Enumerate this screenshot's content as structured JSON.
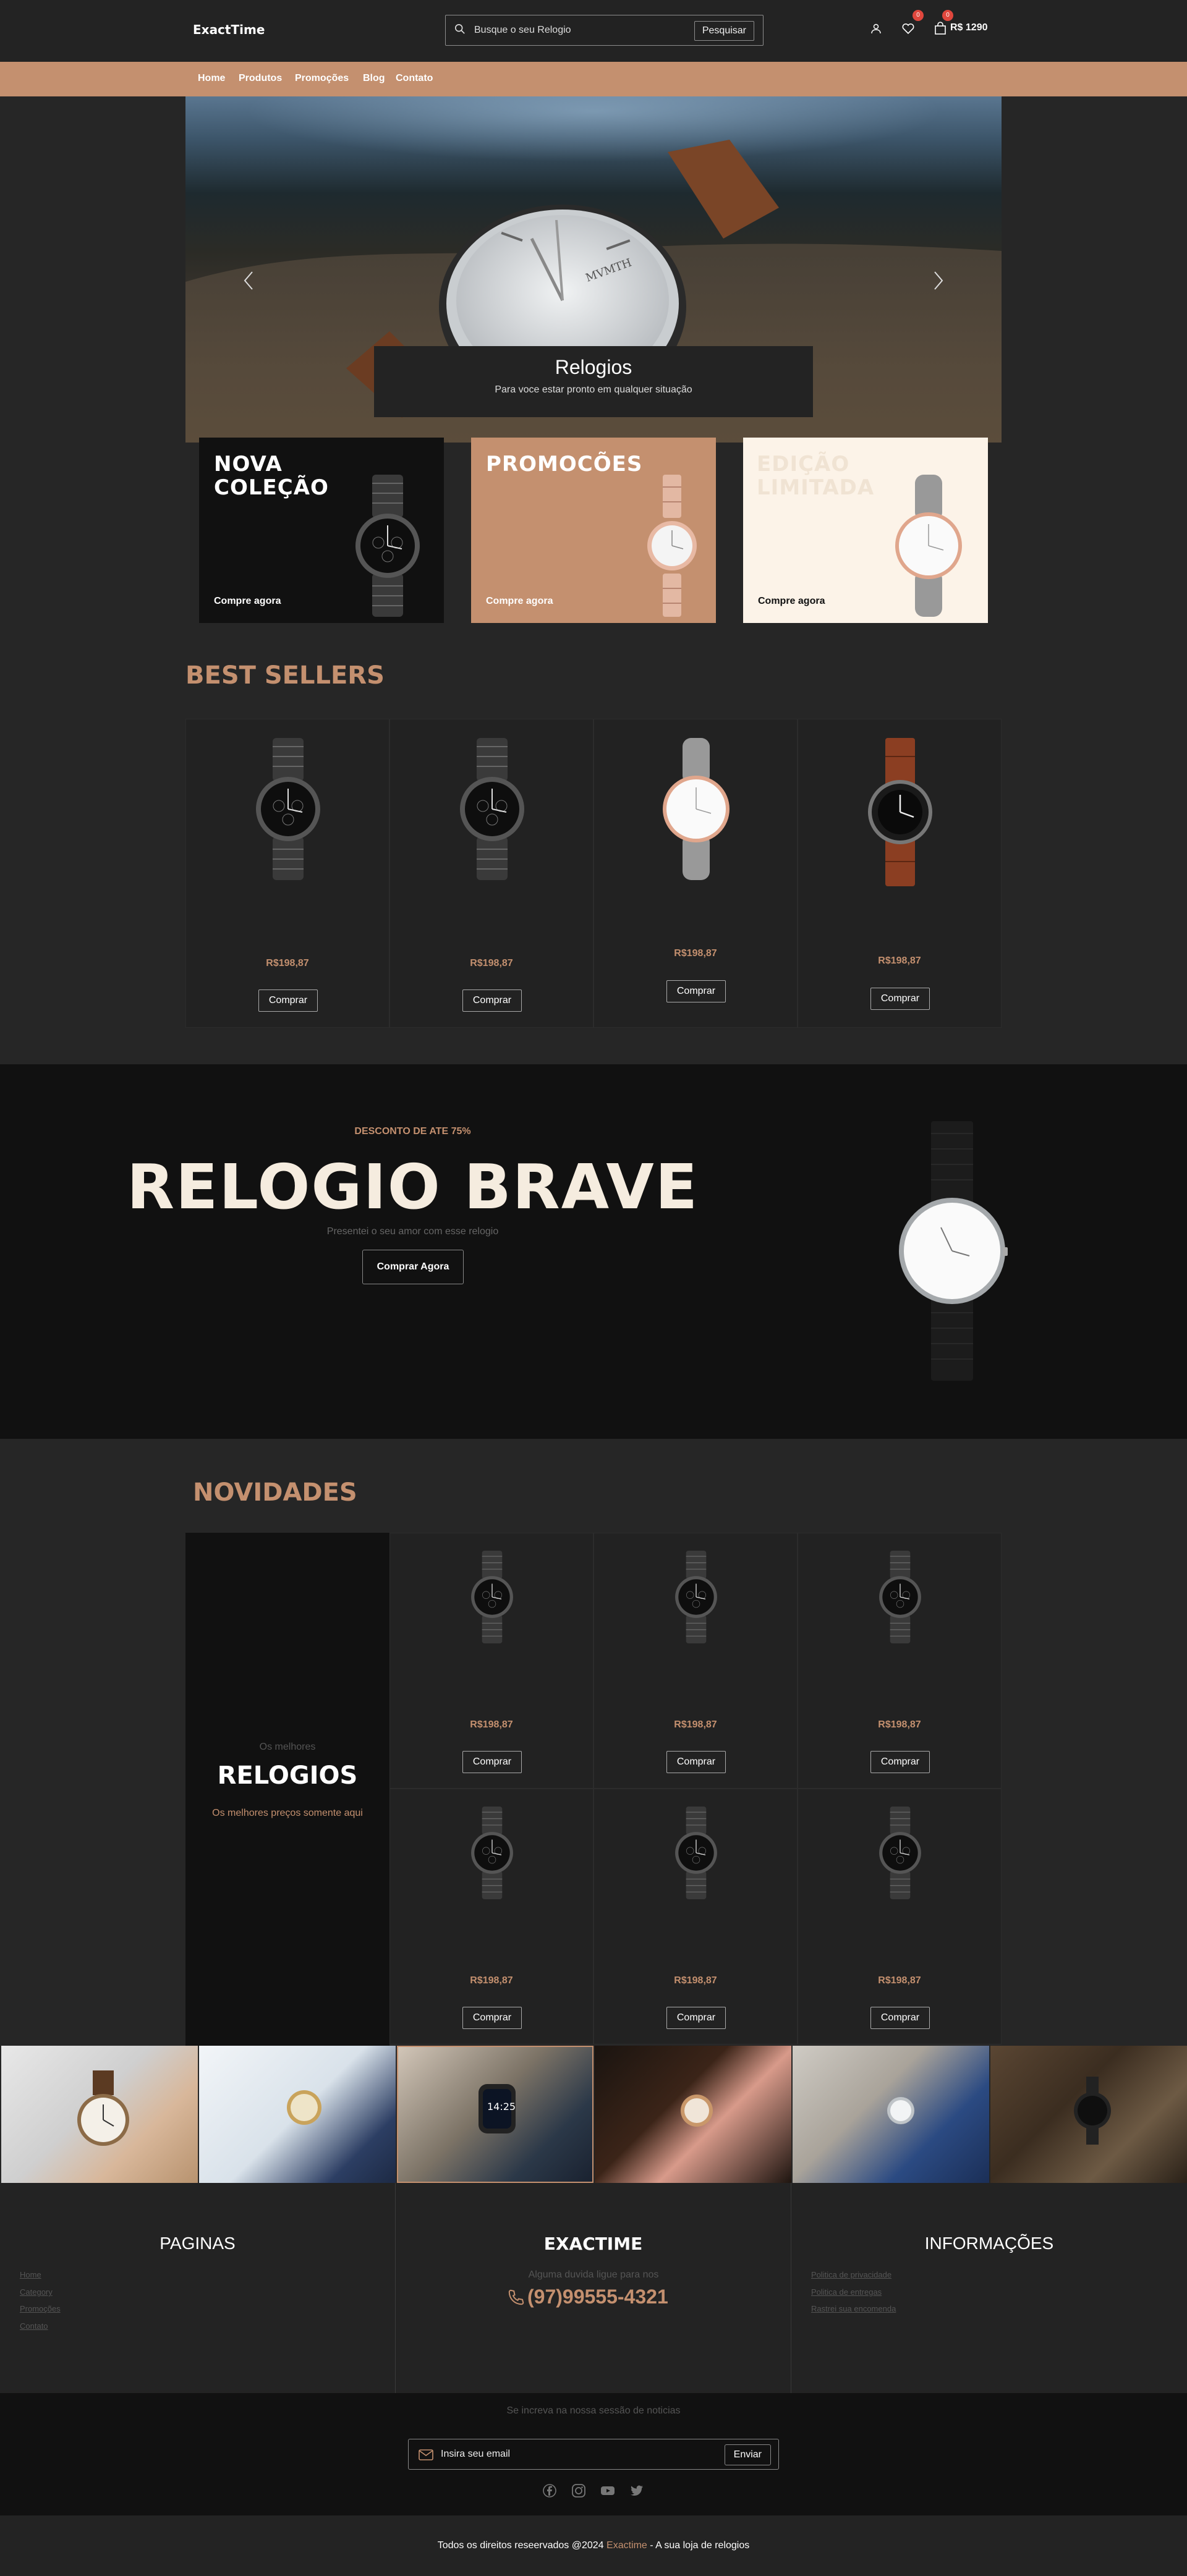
{
  "header": {
    "logo": "ExactTime",
    "search_placeholder": "Busque o seu Relogio",
    "search_button": "Pesquisar",
    "wishlist_count": "0",
    "cart_count": "0",
    "cart_total": "R$ 1290"
  },
  "nav": [
    "Home",
    "Produtos",
    "Promoções",
    "Blog",
    "Contato"
  ],
  "hero": {
    "title": "Relogios",
    "subtitle": "Para voce estar pronto em qualquer situação"
  },
  "promos": [
    {
      "title_line1": "NOVA",
      "title_line2": "COLEÇÃO",
      "cta": "Compre agora",
      "bg": "#111111",
      "text": "#ffffff"
    },
    {
      "title_line1": "PROMOCÕES",
      "title_line2": "",
      "cta": "Compre agora",
      "bg": "#c4906f",
      "text": "#ffffff"
    },
    {
      "title_line1": "EDIÇÃO",
      "title_line2": "LIMITADA",
      "cta": "Compre agora",
      "bg": "#fcf3e8",
      "text": "#f0e3d3"
    }
  ],
  "best_sellers": {
    "title": "BEST SELLERS",
    "products": [
      {
        "price": "R$198,87",
        "button": "Comprar",
        "icon": "black-chronograph-watch"
      },
      {
        "price": "R$198,87",
        "button": "Comprar",
        "icon": "black-chronograph-watch"
      },
      {
        "price": "R$198,87",
        "button": "Comprar",
        "icon": "rose-gold-grey-strap-watch"
      },
      {
        "price": "R$198,87",
        "button": "Comprar",
        "icon": "diver-brown-strap-watch"
      }
    ]
  },
  "brave": {
    "discount": "DESCONTO DE ATE 75%",
    "title": "RELOGIO BRAVE",
    "subtitle": "Presentei o seu amor com esse relogio",
    "button": "Comprar Agora"
  },
  "novidades": {
    "title": "NOVIDADES",
    "panel_small": "Os melhores",
    "panel_big": "RELOGIOS",
    "panel_sub": "Os melhores preços somente aqui",
    "products": [
      {
        "price": "R$198,87",
        "button": "Comprar"
      },
      {
        "price": "R$198,87",
        "button": "Comprar"
      },
      {
        "price": "R$198,87",
        "button": "Comprar"
      },
      {
        "price": "R$198,87",
        "button": "Comprar"
      },
      {
        "price": "R$198,87",
        "button": "Comprar"
      },
      {
        "price": "R$198,87",
        "button": "Comprar"
      }
    ]
  },
  "gallery": [
    "hand-holding-watch",
    "suit-cuff-gold-watch",
    "smartwatch-wrist",
    "woman-rose-gold-watch",
    "man-blue-suit-watch",
    "flatlay-watch-camera"
  ],
  "footer": {
    "paginas_title": "PAGINAS",
    "paginas_links": [
      "Home",
      "Category",
      "Promoções",
      "Contato"
    ],
    "brand_title": "EXACTIME",
    "brand_sub": "Alguma duvida ligue para nos",
    "phone": "(97)99555-4321",
    "info_title": "INFORMAÇÕES",
    "info_links": [
      "Politica de privacidade",
      "Politica de entregas",
      "Rastrei sua encomenda"
    ]
  },
  "newsletter": {
    "label": "Se increva na nossa sessão de noticias",
    "placeholder": "Insira seu email",
    "button": "Enviar"
  },
  "copyright": {
    "before": "Todos os direitos reseervados @2024 ",
    "brand": "Exactime",
    "after": " - A sua loja de relogios"
  },
  "colors": {
    "accent": "#c4906f",
    "bg": "#262626",
    "dark": "#111111",
    "badge": "#e0473d"
  }
}
